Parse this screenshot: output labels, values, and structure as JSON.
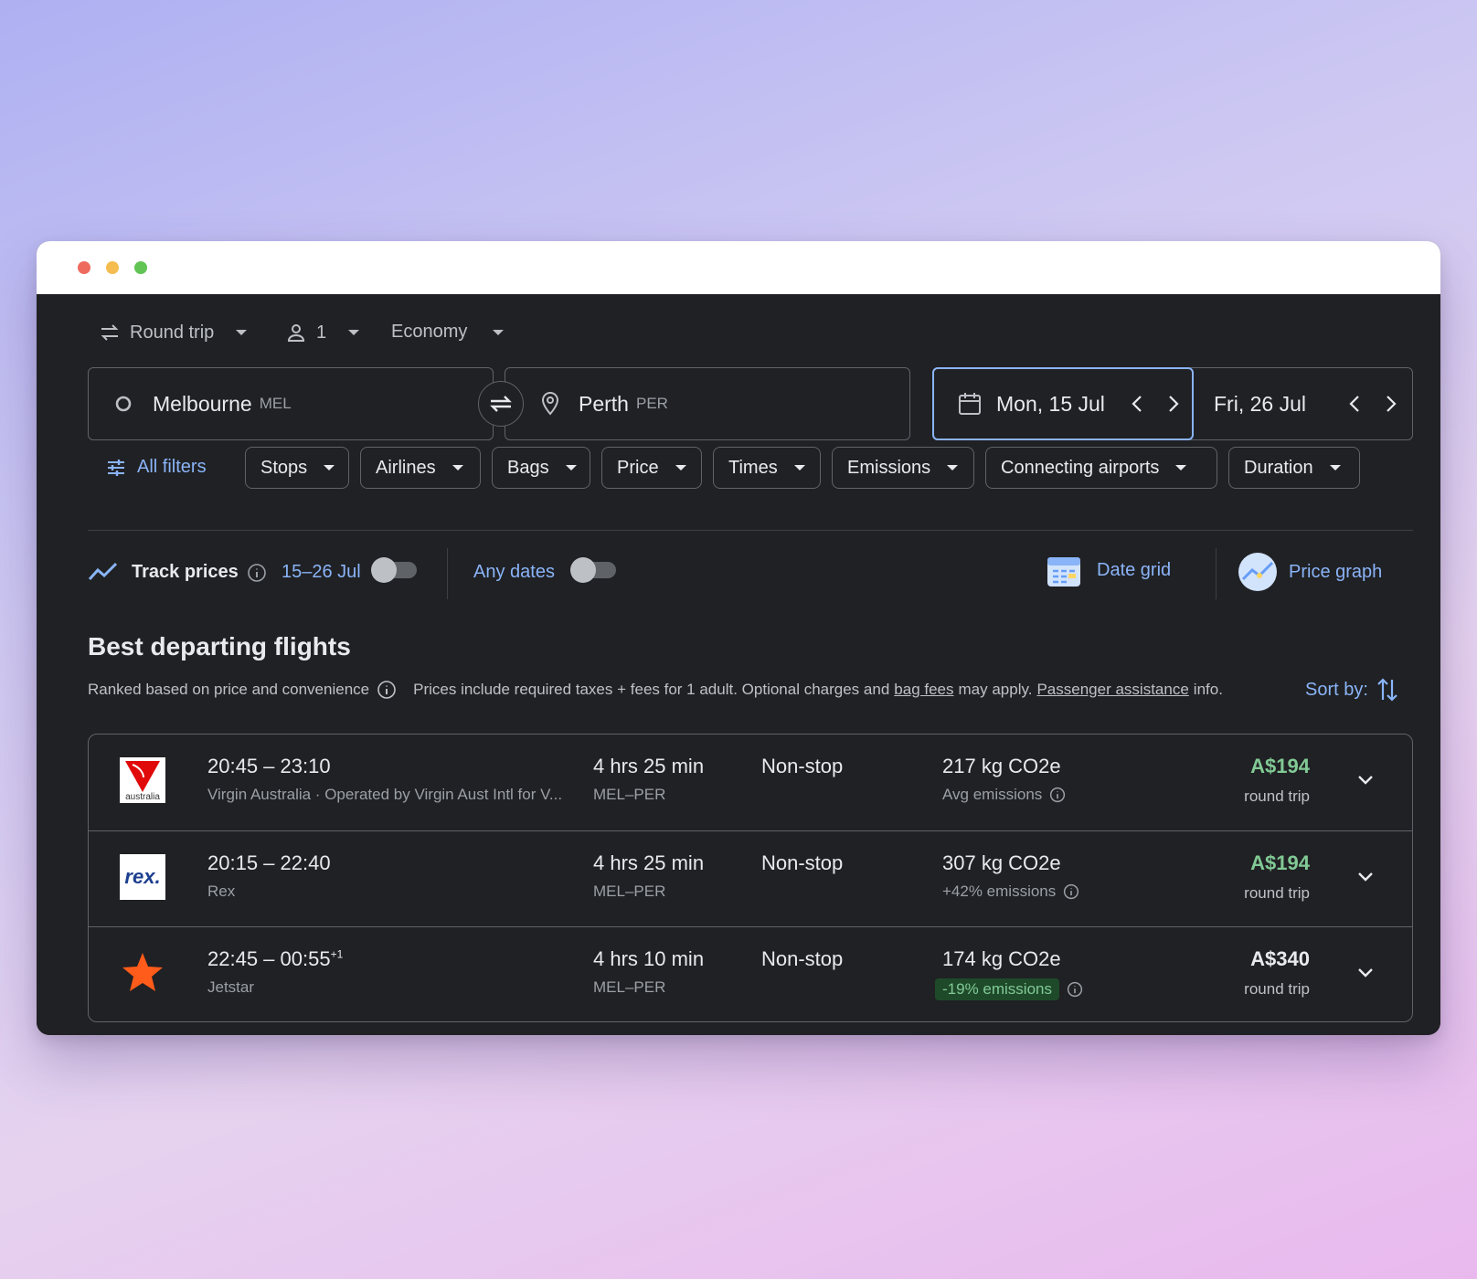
{
  "window": {
    "controls": [
      "close",
      "minimize",
      "maximize"
    ]
  },
  "trip_options": {
    "trip_type": "Round trip",
    "passengers": "1",
    "cabin": "Economy"
  },
  "search": {
    "origin_city": "Melbourne",
    "origin_code": "MEL",
    "destination_city": "Perth",
    "destination_code": "PER",
    "depart_date": "Mon, 15 Jul",
    "return_date": "Fri, 26 Jul"
  },
  "filters": {
    "all_filters": "All filters",
    "chips": [
      "Stops",
      "Airlines",
      "Bags",
      "Price",
      "Times",
      "Emissions",
      "Connecting airports",
      "Duration"
    ]
  },
  "tracking": {
    "track_prices": "Track prices",
    "range": "15–26 Jul",
    "any_dates": "Any dates",
    "date_grid": "Date grid",
    "price_graph": "Price graph"
  },
  "results": {
    "heading": "Best departing flights",
    "ranked_note": "Ranked based on price and convenience",
    "disclaimer_a": "Prices include required taxes + fees for 1 adult. Optional charges and",
    "bag_fees": "bag fees",
    "disclaimer_b": "may apply.",
    "passenger_assistance": "Passenger assistance",
    "disclaimer_c": "info.",
    "sort_by": "Sort by:",
    "flights": [
      {
        "times": "20:45 – 23:10",
        "day_offset": "",
        "airline": "Virgin Australia · Operated by Virgin Aust Intl for V...",
        "duration": "4 hrs 25 min",
        "route": "MEL–PER",
        "stops": "Non-stop",
        "co2": "217 kg CO2e",
        "emissions": "Avg emissions",
        "price": "A$194",
        "price_type": "round trip",
        "logo_text": "australia"
      },
      {
        "times": "20:15 – 22:40",
        "day_offset": "",
        "airline": "Rex",
        "duration": "4 hrs 25 min",
        "route": "MEL–PER",
        "stops": "Non-stop",
        "co2": "307 kg CO2e",
        "emissions": "+42% emissions",
        "price": "A$194",
        "price_type": "round trip",
        "logo_text": "rex."
      },
      {
        "times": "22:45 – 00:55",
        "day_offset": "+1",
        "airline": "Jetstar",
        "duration": "4 hrs 10 min",
        "route": "MEL–PER",
        "stops": "Non-stop",
        "co2": "174 kg CO2e",
        "emissions": "-19% emissions",
        "price": "A$340",
        "price_type": "round trip"
      }
    ]
  },
  "colors": {
    "background": "#202124",
    "accent": "#8ab4f8",
    "price_green": "#81c995",
    "border": "#5f6368"
  },
  "icons": [
    "swap-arrows-icon",
    "person-icon",
    "origin-circle-icon",
    "location-pin-icon",
    "swap-icon",
    "calendar-icon",
    "chevron-left-icon",
    "chevron-right-icon",
    "filter-sliders-icon",
    "trend-line-icon",
    "info-icon",
    "date-grid-icon",
    "price-graph-icon",
    "sort-icon",
    "chevron-down-icon"
  ]
}
